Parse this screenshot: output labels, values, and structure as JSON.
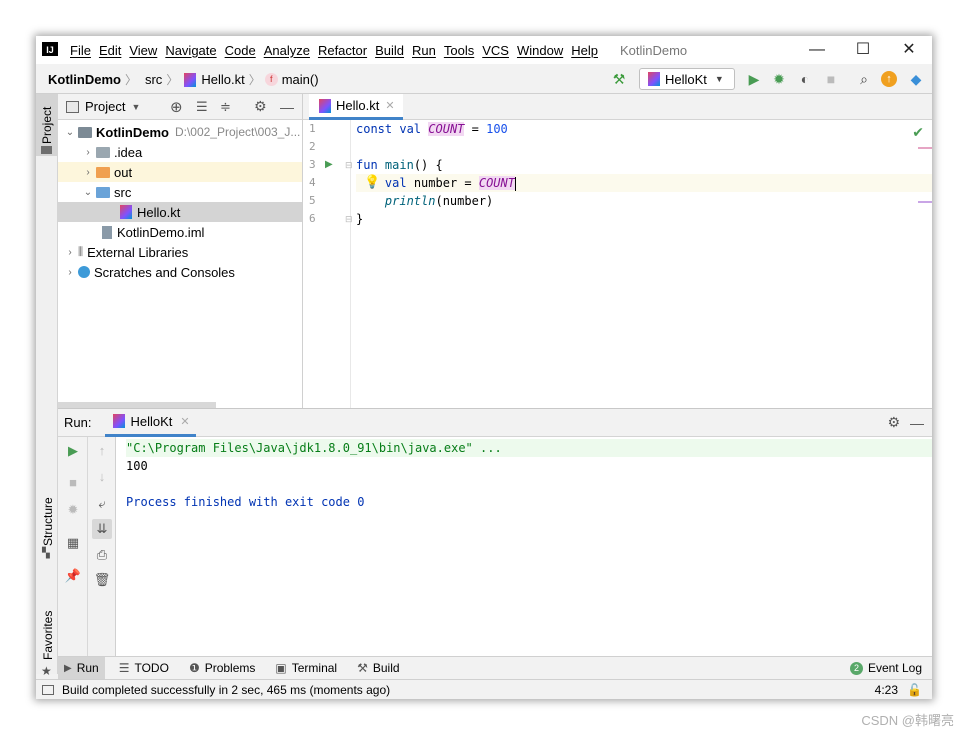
{
  "window": {
    "title": "KotlinDemo",
    "minimize": "—",
    "maximize": "☐",
    "close": "✕"
  },
  "menu": [
    "File",
    "Edit",
    "View",
    "Navigate",
    "Code",
    "Analyze",
    "Refactor",
    "Build",
    "Run",
    "Tools",
    "VCS",
    "Window",
    "Help"
  ],
  "breadcrumb": {
    "project": "KotlinDemo",
    "folder": "src",
    "file": "Hello.kt",
    "func": "main()",
    "func_badge": "f"
  },
  "run_config": "HelloKt",
  "left_tabs": {
    "project": "Project",
    "structure": "Structure",
    "favorites": "Favorites"
  },
  "project_panel": {
    "title": "Project",
    "root": {
      "name": "KotlinDemo",
      "path": "D:\\002_Project\\003_J..."
    },
    "items": [
      {
        "name": ".idea"
      },
      {
        "name": "out"
      },
      {
        "name": "src"
      },
      {
        "name": "Hello.kt"
      },
      {
        "name": "KotlinDemo.iml"
      },
      {
        "name": "External Libraries"
      },
      {
        "name": "Scratches and Consoles"
      }
    ]
  },
  "editor": {
    "tab": "Hello.kt",
    "line_numbers": [
      "1",
      "2",
      "3",
      "4",
      "5",
      "6"
    ],
    "code": {
      "l1_kw1": "const",
      "l1_kw2": "val",
      "l1_const": "COUNT",
      "l1_op": " = ",
      "l1_num": "100",
      "l3_kw": "fun",
      "l3_fn": "main",
      "l3_rest": "() {",
      "l4_kw": "val",
      "l4_var": " number = ",
      "l4_const": "COUNT",
      "l5_fn": "println",
      "l5_rest": "(number)",
      "l6": "}"
    }
  },
  "run_panel": {
    "label": "Run:",
    "tab": "HelloKt",
    "console": [
      "\"C:\\Program Files\\Java\\jdk1.8.0_91\\bin\\java.exe\" ...",
      "100",
      "",
      "Process finished with exit code 0"
    ]
  },
  "bottom_tools": [
    "Run",
    "TODO",
    "Problems",
    "Terminal",
    "Build"
  ],
  "event_log": {
    "label": "Event Log",
    "count": "2"
  },
  "status": {
    "message": "Build completed successfully in 2 sec, 465 ms (moments ago)",
    "position": "4:23"
  },
  "watermark": "CSDN @韩曙亮",
  "colors": {
    "accent": "#4083c9",
    "run_green": "#499c54",
    "keyword": "#0033b3",
    "constant": "#871094"
  }
}
